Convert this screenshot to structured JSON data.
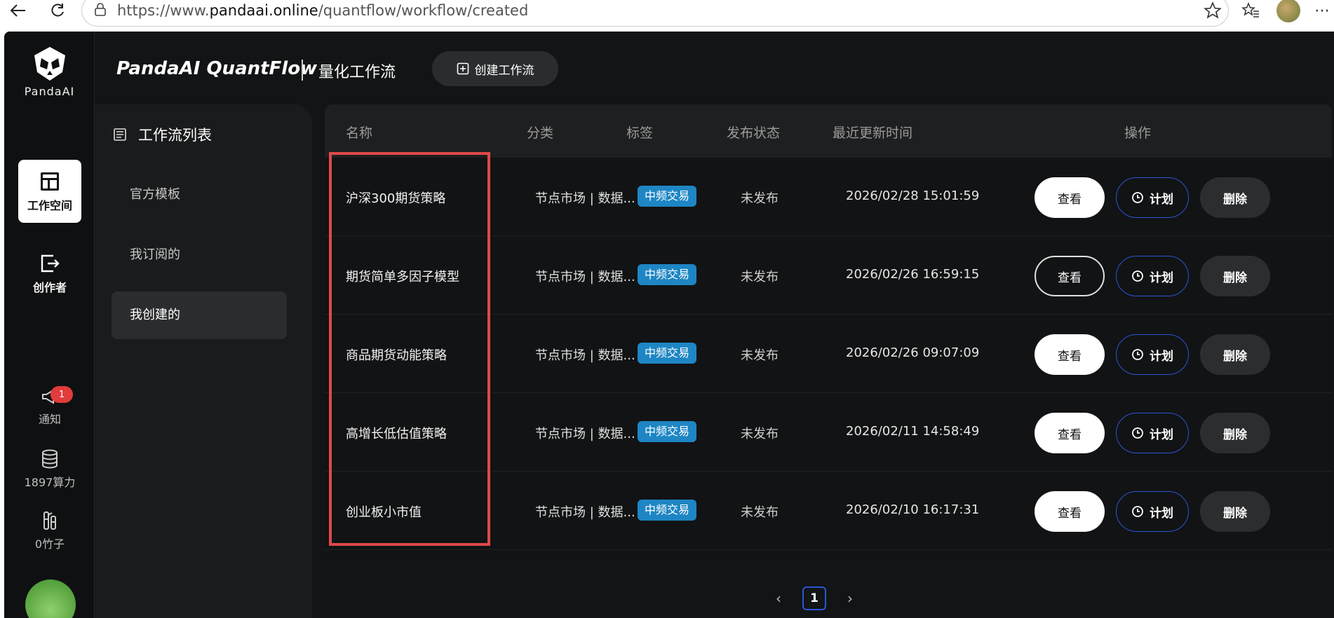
{
  "browser": {
    "url_prefix": "https://www.",
    "url_host": "pandaai.online",
    "url_path": "/quantflow/workflow/created"
  },
  "app": {
    "logo_text": "PandaAI",
    "title": "PandaAI QuantFlow",
    "subtitle": "量化工作流",
    "create_button": "创建工作流"
  },
  "rail": {
    "workspace": "工作空间",
    "creator": "创作者",
    "notify": "通知",
    "notify_badge": "1",
    "power": "1897算力",
    "bamboo": "0竹子"
  },
  "side_panel": {
    "title": "工作流列表",
    "items": [
      "官方模板",
      "我订阅的",
      "我创建的"
    ],
    "active_index": 2
  },
  "table": {
    "headers": [
      "名称",
      "分类",
      "标签",
      "发布状态",
      "最近更新时间",
      "操作"
    ],
    "rows": [
      {
        "name": "沪深300期货策略",
        "category": "节点市场 | 数据...",
        "tag": "中频交易",
        "status": "未发布",
        "time": "2026/02/28 15:01:59"
      },
      {
        "name": "期货简单多因子模型",
        "category": "节点市场 | 数据...",
        "tag": "中频交易",
        "status": "未发布",
        "time": "2026/02/26 16:59:15"
      },
      {
        "name": "商品期货动能策略",
        "category": "节点市场 | 数据...",
        "tag": "中频交易",
        "status": "未发布",
        "time": "2026/02/26 09:07:09"
      },
      {
        "name": "高增长低估值策略",
        "category": "节点市场 | 数据...",
        "tag": "中频交易",
        "status": "未发布",
        "time": "2026/02/11 14:58:49"
      },
      {
        "name": "创业板小市值",
        "category": "节点市场 | 数据...",
        "tag": "中频交易",
        "status": "未发布",
        "time": "2026/02/10 16:17:31"
      }
    ],
    "actions": {
      "view": "查看",
      "plan": "计划",
      "delete": "删除"
    }
  },
  "pager": {
    "current": "1"
  }
}
